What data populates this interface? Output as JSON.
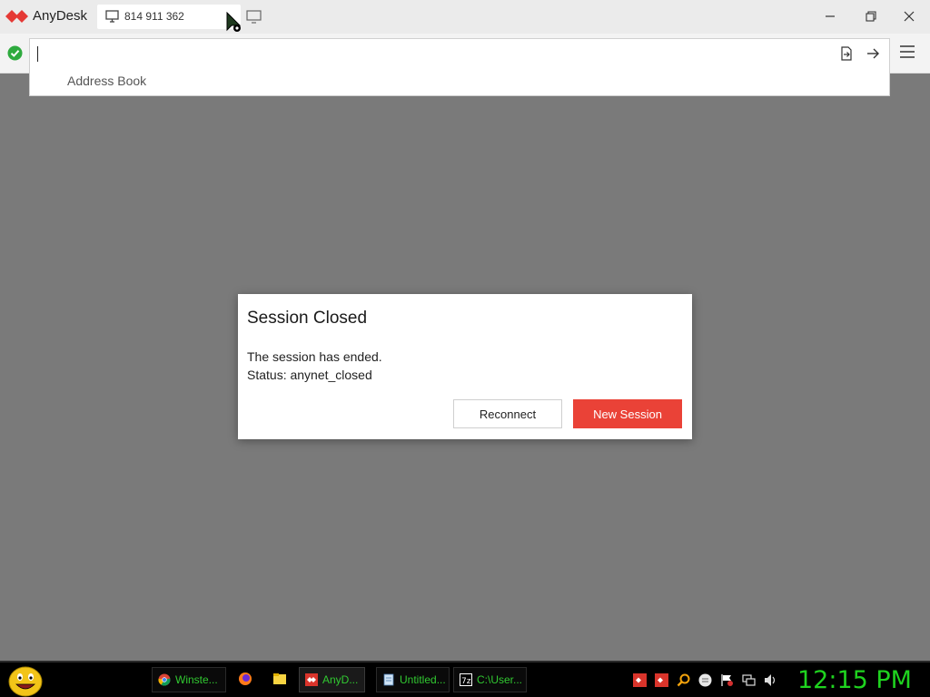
{
  "window": {
    "app_name": "AnyDesk",
    "tab_label": "814 911 362"
  },
  "address_bar": {
    "input_value": "",
    "address_book_label": "Address Book"
  },
  "dialog": {
    "title": "Session Closed",
    "line1": "The session has ended.",
    "line2": "Status: anynet_closed",
    "reconnect_label": "Reconnect",
    "new_session_label": "New Session"
  },
  "taskbar": {
    "tasks": [
      {
        "label": "Winste...",
        "icon": "chrome-icon"
      },
      {
        "label": "AnyD...",
        "icon": "anydesk-icon"
      },
      {
        "label": "Untitled...",
        "icon": "notepad-icon"
      },
      {
        "label": "C:\\User...",
        "icon": "7zip-icon"
      }
    ],
    "clock": "12:15 PM"
  },
  "colors": {
    "accent": "#ea4237",
    "clock_green": "#1fd31f",
    "task_green": "#31c931"
  }
}
